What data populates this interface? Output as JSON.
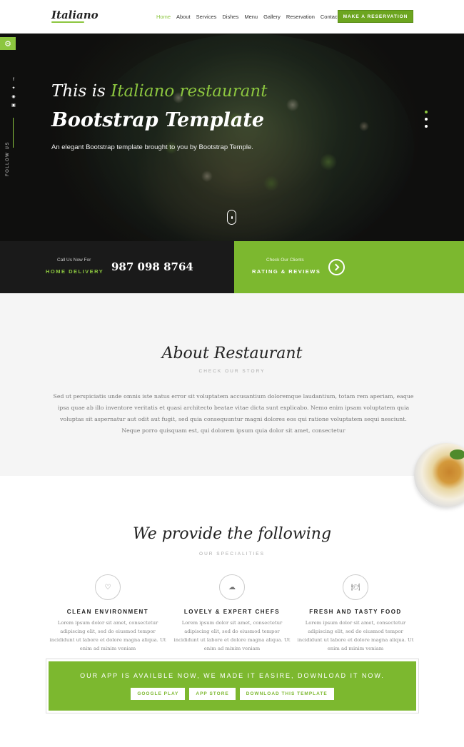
{
  "header": {
    "logo": "Italiano",
    "nav": [
      "Home",
      "About",
      "Services",
      "Dishes",
      "Menu",
      "Gallery",
      "Reservation",
      "Contact"
    ],
    "reserve_label": "MAKE A RESERVATION"
  },
  "hero": {
    "title_prefix": "This is ",
    "title_highlight": "Italiano restaurant",
    "title_main": "Bootstrap Template",
    "subtitle": "An elegant Bootstrap template brought to you by Bootstrap Temple.",
    "follow_label": "FOLLOW US",
    "social_icons": [
      "facebook-icon",
      "twitter-icon",
      "pinterest-icon",
      "instagram-icon"
    ]
  },
  "infobar": {
    "call_label": "Call Us Now For",
    "delivery_label": "HOME DELIVERY",
    "phone": "987 098 8764",
    "clients_label": "Check Our Clients",
    "rating_label": "RATING & REVIEWS"
  },
  "about": {
    "title": "About Restaurant",
    "subtitle": "CHECK OUR STORY",
    "body": "Sed ut perspiciatis unde omnis iste natus error sit voluptatem accusantium doloremque laudantium, totam rem aperiam, eaque ipsa quae ab illo inventore veritatis et quasi architecto beatae vitae dicta sunt explicabo. Nemo enim ipsam voluptatem quia voluptas sit aspernatur aut odit aut fugit, sed quia consequuntur magni dolores eos qui ratione voluptatem sequi nesciunt. Neque porro quisquam est, qui dolorem ipsum quia dolor sit amet, consectetur"
  },
  "specialities": {
    "title": "We provide the following",
    "subtitle": "OUR SPECIALITIES",
    "items": [
      {
        "icon": "heart-icon",
        "title": "CLEAN ENVIRONMENT",
        "text": "Lorem ipsum dolor sit amet, consectetur adipiscing elit, sed do eiusmod tempor incididunt ut labore et dolore magna aliqua. Ut enim ad minim veniam"
      },
      {
        "icon": "chef-hat-icon",
        "title": "LOVELY & EXPERT CHEFS",
        "text": "Lorem ipsum dolor sit amet, consectetur adipiscing elit, sed do eiusmod tempor incididunt ut labore et dolore magna aliqua. Ut enim ad minim veniam"
      },
      {
        "icon": "cutlery-icon",
        "title": "FRESH AND TASTY FOOD",
        "text": "Lorem ipsum dolor sit amet, consectetur adipiscing elit, sed do eiusmod tempor incididunt ut labore et dolore magna aliqua. Ut enim ad minim veniam"
      }
    ]
  },
  "app": {
    "text": "OUR APP IS AVAILBLE NOW, WE MADE IT EASIRE, DOWNLOAD IT NOW.",
    "buttons": [
      "GOOGLE PLAY",
      "APP STORE",
      "DOWNLOAD THIS TEMPLATE"
    ]
  },
  "colors": {
    "accent": "#8cc63f",
    "accent_dark": "#6ca51f",
    "dark": "#1a1a1a"
  }
}
